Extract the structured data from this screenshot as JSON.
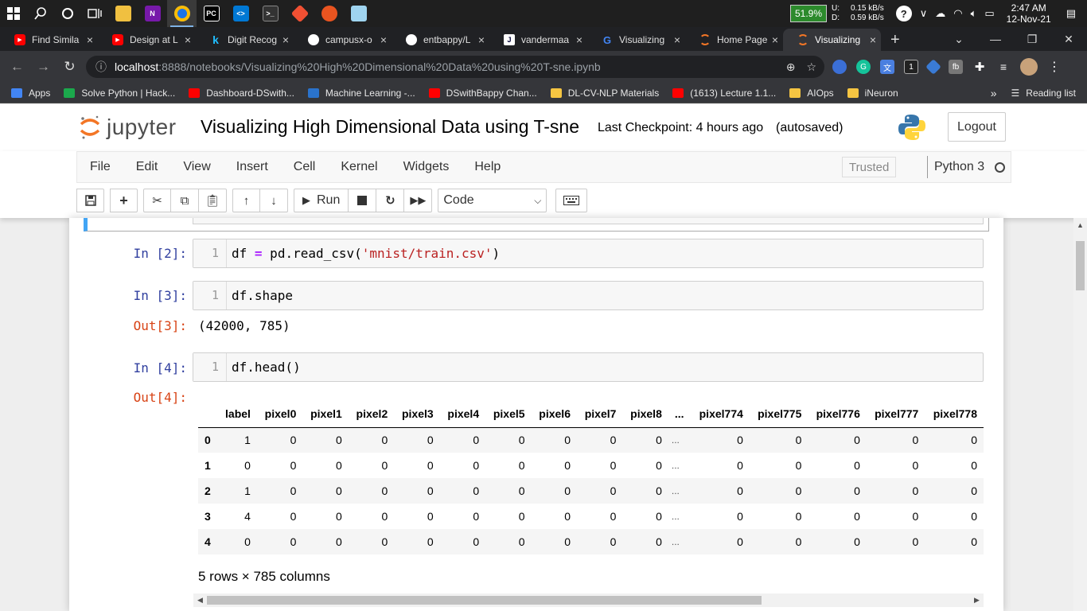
{
  "taskbar": {
    "battery": "51.9%",
    "net_labels": [
      "U:",
      "D:"
    ],
    "net_rates": [
      "0.15 kB/s",
      "0.59 kB/s"
    ],
    "time": "2:47 AM",
    "date": "12-Nov-21"
  },
  "browser": {
    "tabs": [
      {
        "title": "Find Simila",
        "icon": "youtube-icon",
        "color": "#ff0000"
      },
      {
        "title": "Design at L",
        "icon": "youtube-icon",
        "color": "#ff0000"
      },
      {
        "title": "Digit Recog",
        "icon": "kaggle-icon",
        "color": "#20beff"
      },
      {
        "title": "campusx-o",
        "icon": "github-icon",
        "color": "#ffffff"
      },
      {
        "title": "entbappy/L",
        "icon": "github-icon",
        "color": "#ffffff"
      },
      {
        "title": "vandermaa",
        "icon": "jmlr-icon",
        "color": "#ffffff"
      },
      {
        "title": "Visualizing",
        "icon": "google-icon",
        "color": "#4285f4"
      },
      {
        "title": "Home Page",
        "icon": "jupyter-icon",
        "color": "#f37626"
      },
      {
        "title": "Visualizing",
        "icon": "jupyter-icon",
        "color": "#f37626",
        "active": true
      }
    ],
    "url_host": "localhost",
    "url_path": ":8888/notebooks/Visualizing%20High%20Dimensional%20Data%20using%20T-sne.ipynb",
    "bookmarks": [
      {
        "label": "Apps",
        "color": "#4285f4"
      },
      {
        "label": "Solve Python | Hack...",
        "color": "#1ba94c"
      },
      {
        "label": "Dashboard-DSwith...",
        "color": "#ff0000"
      },
      {
        "label": "Machine Learning -...",
        "color": "#2a73cc"
      },
      {
        "label": "DSwithBappy Chan...",
        "color": "#ff0000"
      },
      {
        "label": "DL-CV-NLP Materials",
        "color": "#f5c542"
      },
      {
        "label": "(1613) Lecture 1.1...",
        "color": "#ff0000"
      },
      {
        "label": "AIOps",
        "color": "#f5c542"
      },
      {
        "label": "iNeuron",
        "color": "#f5c542"
      }
    ],
    "reading_list": "Reading list",
    "more_bookmarks": "»"
  },
  "jupyter": {
    "logo_text": "jupyter",
    "notebook_title": "Visualizing High Dimensional Data using T-sne",
    "checkpoint": "Last Checkpoint: 4 hours ago",
    "autosave": "(autosaved)",
    "logout": "Logout",
    "menu": [
      "File",
      "Edit",
      "View",
      "Insert",
      "Cell",
      "Kernel",
      "Widgets",
      "Help"
    ],
    "trusted": "Trusted",
    "kernel": "Python 3",
    "run_label": "Run",
    "cell_type": "Code"
  },
  "cells": [
    {
      "prompt": "In [2]:",
      "line": "1",
      "code_parts": [
        "df ",
        "=",
        " pd.read_csv(",
        "'mnist/train.csv'",
        ")"
      ]
    },
    {
      "prompt": "In [3]:",
      "line": "1",
      "code": "df.shape",
      "out_prompt": "Out[3]:",
      "output": "(42000, 785)"
    },
    {
      "prompt": "In [4]:",
      "line": "1",
      "code": "df.head()",
      "out_prompt": "Out[4]:"
    }
  ],
  "dataframe": {
    "columns": [
      "label",
      "pixel0",
      "pixel1",
      "pixel2",
      "pixel3",
      "pixel4",
      "pixel5",
      "pixel6",
      "pixel7",
      "pixel8",
      "...",
      "pixel774",
      "pixel775",
      "pixel776",
      "pixel777",
      "pixel778"
    ],
    "index": [
      "0",
      "1",
      "2",
      "3",
      "4"
    ],
    "rows": [
      [
        "1",
        "0",
        "0",
        "0",
        "0",
        "0",
        "0",
        "0",
        "0",
        "0",
        "...",
        "0",
        "0",
        "0",
        "0",
        "0"
      ],
      [
        "0",
        "0",
        "0",
        "0",
        "0",
        "0",
        "0",
        "0",
        "0",
        "0",
        "...",
        "0",
        "0",
        "0",
        "0",
        "0"
      ],
      [
        "1",
        "0",
        "0",
        "0",
        "0",
        "0",
        "0",
        "0",
        "0",
        "0",
        "...",
        "0",
        "0",
        "0",
        "0",
        "0"
      ],
      [
        "4",
        "0",
        "0",
        "0",
        "0",
        "0",
        "0",
        "0",
        "0",
        "0",
        "...",
        "0",
        "0",
        "0",
        "0",
        "0"
      ],
      [
        "0",
        "0",
        "0",
        "0",
        "0",
        "0",
        "0",
        "0",
        "0",
        "0",
        "...",
        "0",
        "0",
        "0",
        "0",
        "0"
      ]
    ],
    "summary": "5 rows × 785 columns"
  }
}
